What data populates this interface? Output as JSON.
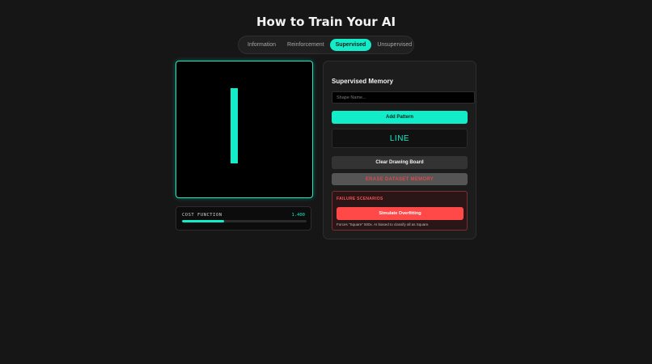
{
  "page": {
    "title": "How to Train Your AI"
  },
  "tabs": [
    {
      "label": "Information",
      "active": false
    },
    {
      "label": "Reinforcement",
      "active": false
    },
    {
      "label": "Supervised",
      "active": true
    },
    {
      "label": "Unsupervised",
      "active": false
    }
  ],
  "cost": {
    "label": "COST FUNCTION",
    "value": "1.400",
    "progress_fraction": 0.34
  },
  "panel": {
    "title": "Supervised Memory",
    "shape_input": {
      "value": "",
      "placeholder": "Shape Name..."
    },
    "add_label": "Add Pattern",
    "prediction": "LINE",
    "clear_label": "Clear Drawing Board",
    "erase_label": "ERASE DATASET MEMORY",
    "failure": {
      "title": "FAILURE SCENARIOS",
      "button_label": "Simulate Overfitting",
      "note": "Forces \"Square\" 500x. AI biased to classify all as Square."
    }
  },
  "colors": {
    "accent": "#13ecc8",
    "background": "#161616",
    "panel": "#1c1c1c",
    "danger": "#ff4848"
  }
}
